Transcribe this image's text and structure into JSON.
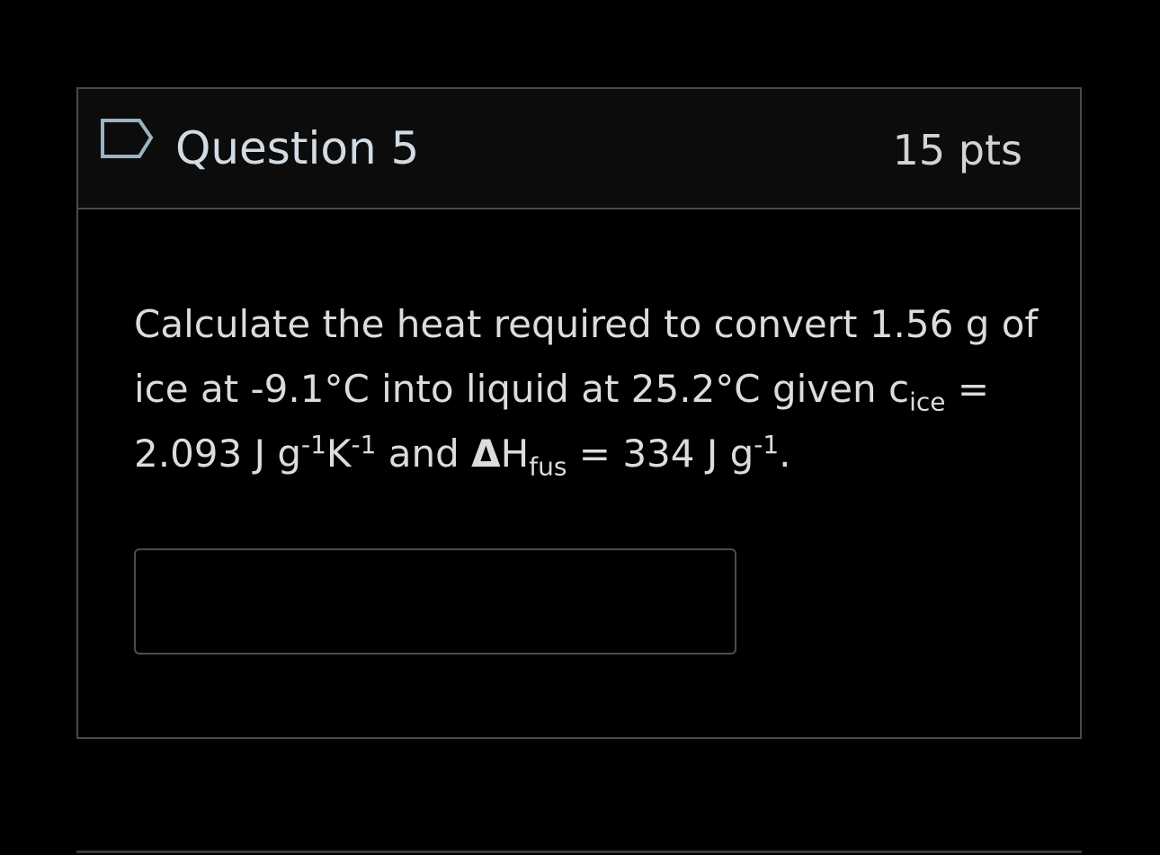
{
  "question": {
    "title": "Question 5",
    "points": "15 pts",
    "flag_icon": "flag-icon",
    "text": {
      "line1": "Calculate the heat required to convert 1.56 g of ice at -9.1°C into liquid at 25.2°C given c",
      "c_sub": "ice",
      "mid": " = 2.093 J g",
      "exp1": "-1",
      "k": "K",
      "exp2": "-1",
      "and": " and ",
      "delta": "Δ",
      "h": "H",
      "h_sub": "fus",
      "end": " = 334 J g",
      "exp3": "-1",
      "period": "."
    }
  },
  "answer": {
    "value": "",
    "placeholder": ""
  },
  "colors": {
    "background": "#000000",
    "header_bg": "#0c0c0c",
    "border": "#4a4a4a",
    "title_text": "#d3dbe2",
    "body_text": "#dcdcdc",
    "flag_stroke": "#9bb3c2"
  }
}
